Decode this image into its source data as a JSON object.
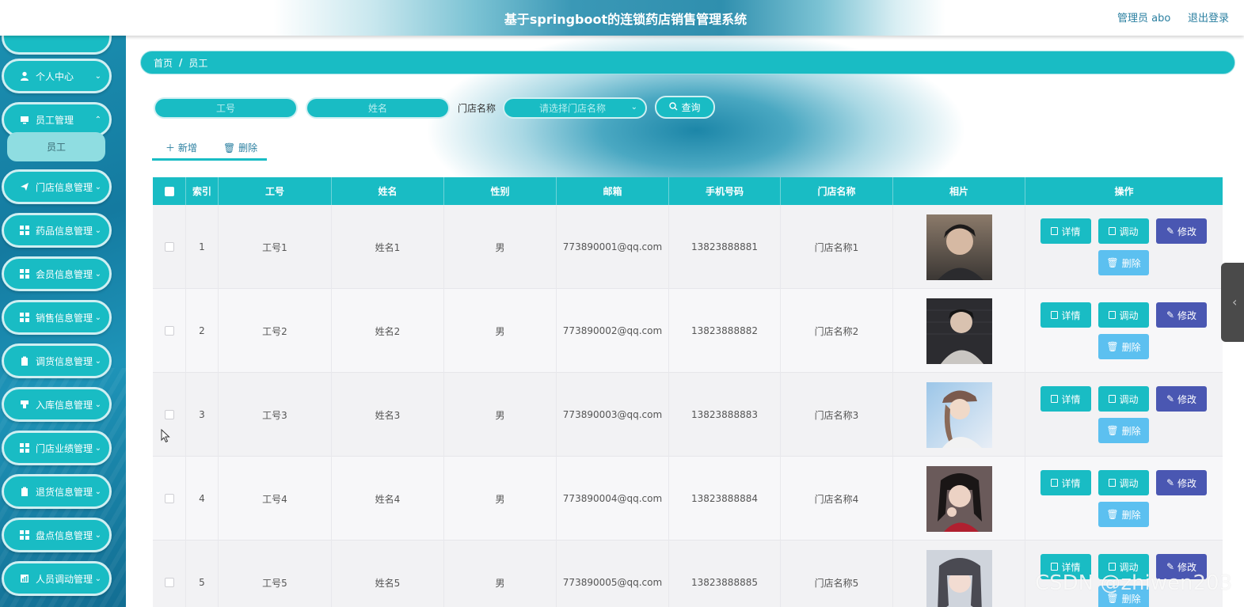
{
  "header": {
    "title": "基于springboot的连锁药店销售管理系统",
    "user": "管理员 abo",
    "logout": "退出登录"
  },
  "sidebar": {
    "items": [
      {
        "label": "个人中心",
        "icon": "user-icon"
      },
      {
        "label": "员工管理",
        "icon": "monitor-icon"
      },
      {
        "label": "门店信息管理",
        "icon": "send-icon"
      },
      {
        "label": "药品信息管理",
        "icon": "grid-icon"
      },
      {
        "label": "会员信息管理",
        "icon": "grid-icon"
      },
      {
        "label": "销售信息管理",
        "icon": "grid-icon"
      },
      {
        "label": "调货信息管理",
        "icon": "clipboard-icon"
      },
      {
        "label": "入库信息管理",
        "icon": "stamp-icon"
      },
      {
        "label": "门店业绩管理",
        "icon": "grid-icon"
      },
      {
        "label": "退货信息管理",
        "icon": "clipboard-icon"
      },
      {
        "label": "盘点信息管理",
        "icon": "grid-icon"
      },
      {
        "label": "人员调动管理",
        "icon": "chart-icon"
      }
    ],
    "sub_active": "员工"
  },
  "breadcrumb": {
    "home": "首页",
    "sep": "/",
    "current": "员工"
  },
  "search": {
    "emp_no_placeholder": "工号",
    "name_placeholder": "姓名",
    "store_label": "门店名称",
    "store_placeholder": "请选择门店名称",
    "query_label": "查询"
  },
  "toolbar": {
    "add_label": "新增",
    "delete_label": "删除"
  },
  "table": {
    "headers": [
      "",
      "索引",
      "工号",
      "姓名",
      "性别",
      "邮箱",
      "手机号码",
      "门店名称",
      "相片",
      "操作"
    ],
    "rows": [
      {
        "index": "1",
        "emp_no": "工号1",
        "name": "姓名1",
        "gender": "男",
        "email": "773890001@qq.com",
        "phone": "13823888881",
        "store": "门店名称1"
      },
      {
        "index": "2",
        "emp_no": "工号2",
        "name": "姓名2",
        "gender": "男",
        "email": "773890002@qq.com",
        "phone": "13823888882",
        "store": "门店名称2"
      },
      {
        "index": "3",
        "emp_no": "工号3",
        "name": "姓名3",
        "gender": "男",
        "email": "773890003@qq.com",
        "phone": "13823888883",
        "store": "门店名称3"
      },
      {
        "index": "4",
        "emp_no": "工号4",
        "name": "姓名4",
        "gender": "男",
        "email": "773890004@qq.com",
        "phone": "13823888884",
        "store": "门店名称4"
      },
      {
        "index": "5",
        "emp_no": "工号5",
        "name": "姓名5",
        "gender": "男",
        "email": "773890005@qq.com",
        "phone": "13823888885",
        "store": "门店名称5"
      }
    ],
    "actions": {
      "detail": "详情",
      "transfer": "调动",
      "edit": "修改",
      "delete": "删除"
    }
  },
  "watermark": "CSDN @zhiwen203",
  "colors": {
    "primary": "#19bcc4",
    "edit": "#4a57b2",
    "delete": "#5cc0f0",
    "sidebar": "#147aa0"
  }
}
